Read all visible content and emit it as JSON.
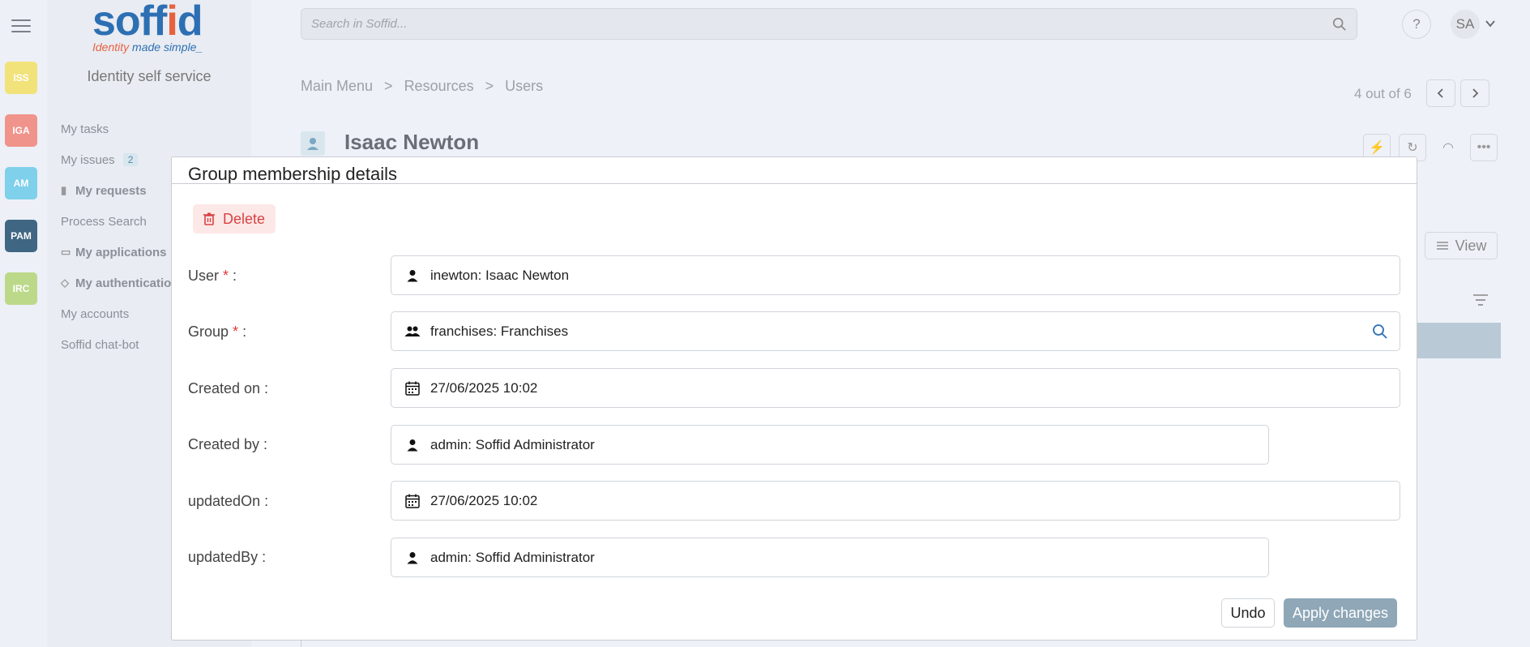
{
  "logo": {
    "brand_part1": "soff",
    "brand_part2": "i",
    "brand_part3": "d",
    "tagline_part1": "Identity",
    "tagline_part2": " made simple_"
  },
  "rail": {
    "apps": [
      {
        "label": "ISS",
        "color": "#f2e27a"
      },
      {
        "label": "IGA",
        "color": "#f0938b"
      },
      {
        "label": "AM",
        "color": "#7fd0ea"
      },
      {
        "label": "PAM",
        "color": "#3f6682"
      },
      {
        "label": "IRC",
        "color": "#bcd98a"
      }
    ]
  },
  "sidebar": {
    "title": "Identity self service",
    "items": [
      {
        "label": "My tasks",
        "icon": "",
        "bold": false
      },
      {
        "label": "My issues",
        "badge": "2",
        "bold": false
      },
      {
        "label": "My requests",
        "icon": "clipboard-icon",
        "bold": true
      },
      {
        "label": "Process Search",
        "bold": false
      },
      {
        "label": "My applications",
        "icon": "monitor-icon",
        "bold": true
      },
      {
        "label": "My authentication",
        "icon": "tag-icon",
        "bold": true
      },
      {
        "label": "My accounts",
        "bold": false
      },
      {
        "label": "Soffid chat-bot",
        "bold": false
      }
    ]
  },
  "topbar": {
    "search_placeholder": "Search in Soffid...",
    "help_label": "?",
    "avatar_initials": "SA"
  },
  "breadcrumb": [
    "Main Menu",
    "Resources",
    "Users"
  ],
  "breadcrumb_separator": ">",
  "pager": {
    "text": "4 out of 6"
  },
  "page": {
    "title": "Isaac Newton",
    "view_label": "View"
  },
  "modal": {
    "title": "Group membership details",
    "delete_label": "Delete",
    "fields": [
      {
        "label": "User",
        "required": true,
        "suffix": " :",
        "value": "inewton: Isaac Newton",
        "icon": "user-icon"
      },
      {
        "label": "Group",
        "required": true,
        "suffix": " :",
        "value": "franchises: Franchises",
        "icon": "group-icon"
      },
      {
        "label": "Created on :",
        "required": false,
        "value": "27/06/2025 10:02",
        "icon": "calendar-icon"
      },
      {
        "label": "Created by :",
        "required": false,
        "value": "admin: Soffid Administrator",
        "icon": "user-icon"
      },
      {
        "label": "updatedOn :",
        "required": false,
        "value": "27/06/2025 10:02",
        "icon": "calendar-icon"
      },
      {
        "label": "updatedBy :",
        "required": false,
        "value": "admin: Soffid Administrator",
        "icon": "user-icon"
      }
    ],
    "required_mark": "*",
    "undo_label": "Undo",
    "apply_label": "Apply changes"
  },
  "colors": {
    "accent": "#2d6fb3",
    "danger": "#d84242",
    "apply": "#8fa7b7"
  }
}
